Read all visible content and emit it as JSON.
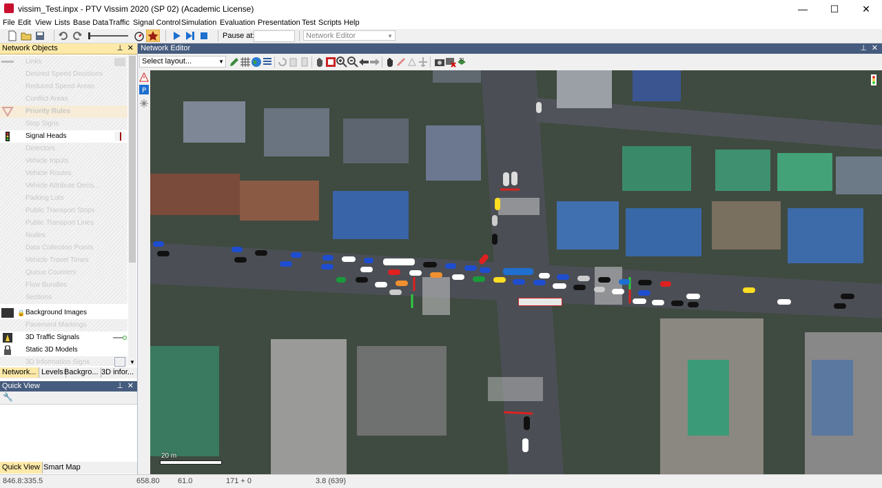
{
  "window": {
    "title": "vissim_Test.inpx - PTV Vissim 2020 (SP 02) (Academic License)",
    "minimize": "—",
    "maximize": "☐",
    "close": "✕"
  },
  "menu": [
    "File",
    "Edit",
    "View",
    "Lists",
    "Base Data",
    "Traffic",
    "Signal Control",
    "Simulation",
    "Evaluation",
    "Presentation",
    "Test",
    "Scripts",
    "Help"
  ],
  "toolbar": {
    "pause_label": "Pause at:",
    "pause_value": "",
    "editor_select": "Network Editor"
  },
  "network_objects": {
    "title": "Network Objects",
    "items": [
      {
        "label": "Links",
        "enabled": false
      },
      {
        "label": "Desired Speed Decisions",
        "enabled": false
      },
      {
        "label": "Reduced Speed Areas",
        "enabled": false
      },
      {
        "label": "Conflict Areas",
        "enabled": false
      },
      {
        "label": "Priority Rules",
        "enabled": false
      },
      {
        "label": "Stop Signs",
        "enabled": false
      },
      {
        "label": "Signal Heads",
        "enabled": true
      },
      {
        "label": "Detectors",
        "enabled": false
      },
      {
        "label": "Vehicle Inputs",
        "enabled": false
      },
      {
        "label": "Vehicle Routes",
        "enabled": false
      },
      {
        "label": "Vehicle Attribute Decis...",
        "enabled": false
      },
      {
        "label": "Parking Lots",
        "enabled": false
      },
      {
        "label": "Public Transport Stops",
        "enabled": false
      },
      {
        "label": "Public Transport Lines",
        "enabled": false
      },
      {
        "label": "Nodes",
        "enabled": false
      },
      {
        "label": "Data Collection Points",
        "enabled": false
      },
      {
        "label": "Vehicle Travel Times",
        "enabled": false
      },
      {
        "label": "Queue Counters",
        "enabled": false
      },
      {
        "label": "Flow Bundles",
        "enabled": false
      },
      {
        "label": "Sections",
        "enabled": false
      },
      {
        "label": "Background Images",
        "enabled": true
      },
      {
        "label": "Pavement Markings",
        "enabled": false
      },
      {
        "label": "3D Traffic Signals",
        "enabled": true
      },
      {
        "label": "Static 3D Models",
        "enabled": true
      },
      {
        "label": "3D Information Signs",
        "enabled": false
      }
    ],
    "tabs": [
      "Network...",
      "Levels",
      "Backgro...",
      "3D infor..."
    ]
  },
  "quick_view": {
    "title": "Quick View",
    "tabs": [
      "Quick View",
      "Smart Map"
    ]
  },
  "network_editor": {
    "title": "Network Editor",
    "layout_select": "Select layout...",
    "scale_label": "20 m"
  },
  "status": {
    "coords": "846.8:335.5",
    "sim_time": "658.80",
    "speed": "61.0",
    "vehicles": "171 + 0",
    "fps": "3.8 (639)"
  },
  "colors": {
    "panel_header": "#465c7e",
    "object_header": "#fde9a8",
    "accent_blue": "#1e6fd0"
  }
}
